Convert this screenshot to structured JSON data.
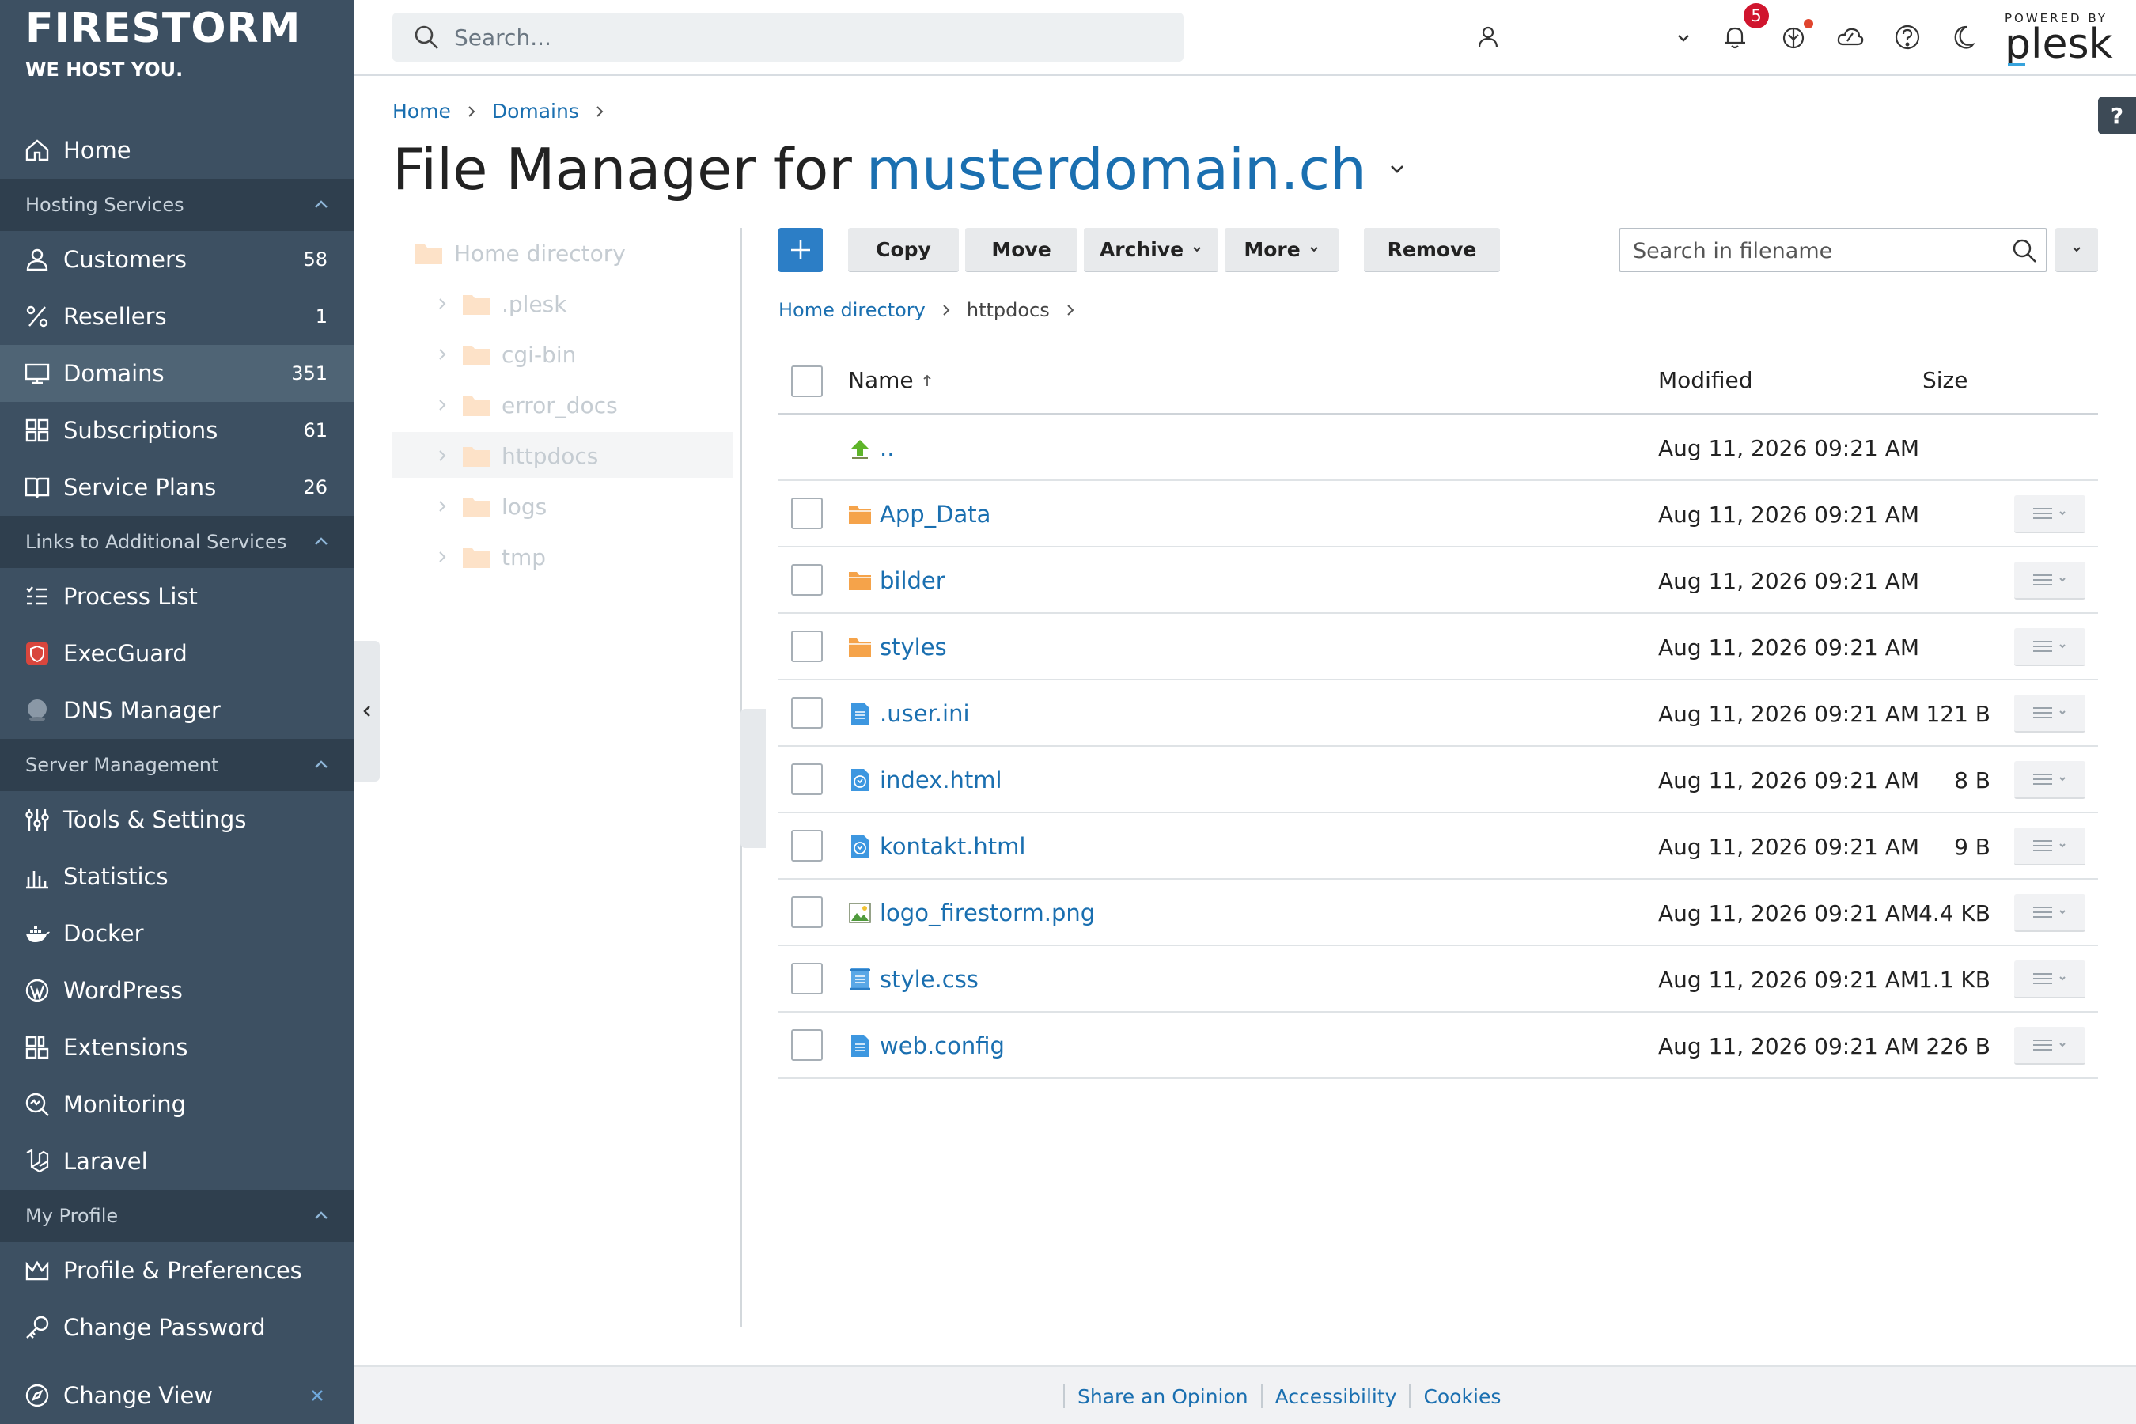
{
  "brand": {
    "name": "FIRESTORM",
    "tagline": "WE HOST YOU."
  },
  "sidebar": {
    "home": "Home",
    "sections": [
      {
        "label": "Hosting Services"
      },
      {
        "label": "Links to Additional Services"
      },
      {
        "label": "Server Management"
      },
      {
        "label": "My Profile"
      }
    ],
    "hosting": [
      {
        "label": "Customers",
        "count": "58",
        "icon": "user-icon"
      },
      {
        "label": "Resellers",
        "count": "1",
        "icon": "percent-icon"
      },
      {
        "label": "Domains",
        "count": "351",
        "icon": "monitor-icon"
      },
      {
        "label": "Subscriptions",
        "count": "61",
        "icon": "grid-icon"
      },
      {
        "label": "Service Plans",
        "count": "26",
        "icon": "book-icon"
      }
    ],
    "links": [
      {
        "label": "Process List",
        "icon": "list-icon"
      },
      {
        "label": "ExecGuard",
        "icon": "shield-icon"
      },
      {
        "label": "DNS Manager",
        "icon": "globe-icon"
      }
    ],
    "server": [
      {
        "label": "Tools & Settings",
        "icon": "sliders-icon"
      },
      {
        "label": "Statistics",
        "icon": "bar-chart-icon"
      },
      {
        "label": "Docker",
        "icon": "whale-icon"
      },
      {
        "label": "WordPress",
        "icon": "wordpress-icon"
      },
      {
        "label": "Extensions",
        "icon": "puzzle-icon"
      },
      {
        "label": "Monitoring",
        "icon": "monitor-search-icon"
      },
      {
        "label": "Laravel",
        "icon": "laravel-icon"
      }
    ],
    "profile": [
      {
        "label": "Profile & Preferences",
        "icon": "crown-icon"
      },
      {
        "label": "Change Password",
        "icon": "key-icon"
      }
    ],
    "change_view": "Change View"
  },
  "topbar": {
    "search_placeholder": "Search...",
    "notification_count": "5",
    "powered_by": "POWERED BY",
    "plesk": "plesk"
  },
  "breadcrumb": [
    "Home",
    "Domains"
  ],
  "title": {
    "prefix": "File Manager for",
    "domain": "musterdomain.ch"
  },
  "tree": {
    "root": "Home directory",
    "children": [
      ".plesk",
      "cgi-bin",
      "error_docs",
      "httpdocs",
      "logs",
      "tmp"
    ]
  },
  "toolbar": {
    "copy": "Copy",
    "move": "Move",
    "archive": "Archive",
    "more": "More",
    "remove": "Remove",
    "search_placeholder": "Search in filename"
  },
  "path": {
    "root": "Home directory",
    "current": "httpdocs"
  },
  "table": {
    "columns": {
      "name": "Name",
      "modified": "Modified",
      "size": "Size"
    },
    "rows": [
      {
        "name": "..",
        "modified": "Aug 11, 2026 09:21 AM",
        "size": "",
        "type": "up"
      },
      {
        "name": "App_Data",
        "modified": "Aug 11, 2026 09:21 AM",
        "size": "",
        "type": "folder"
      },
      {
        "name": "bilder",
        "modified": "Aug 11, 2026 09:21 AM",
        "size": "",
        "type": "folder"
      },
      {
        "name": "styles",
        "modified": "Aug 11, 2026 09:21 AM",
        "size": "",
        "type": "folder"
      },
      {
        "name": ".user.ini",
        "modified": "Aug 11, 2026 09:21 AM",
        "size": "121 B",
        "type": "text"
      },
      {
        "name": "index.html",
        "modified": "Aug 11, 2026 09:21 AM",
        "size": "8 B",
        "type": "html"
      },
      {
        "name": "kontakt.html",
        "modified": "Aug 11, 2026 09:21 AM",
        "size": "9 B",
        "type": "html"
      },
      {
        "name": "logo_firestorm.png",
        "modified": "Aug 11, 2026 09:21 AM",
        "size": "4.4 KB",
        "type": "image"
      },
      {
        "name": "style.css",
        "modified": "Aug 11, 2026 09:21 AM",
        "size": "1.1 KB",
        "type": "css"
      },
      {
        "name": "web.config",
        "modified": "Aug 11, 2026 09:21 AM",
        "size": "226 B",
        "type": "text"
      }
    ]
  },
  "footer": {
    "links": [
      "Share an Opinion",
      "Accessibility",
      "Cookies"
    ]
  },
  "colors": {
    "sidebar": "#3d5062",
    "accent": "#1a6fb0",
    "primary_button": "#2c7ec6",
    "folder": "#f5a34a"
  }
}
